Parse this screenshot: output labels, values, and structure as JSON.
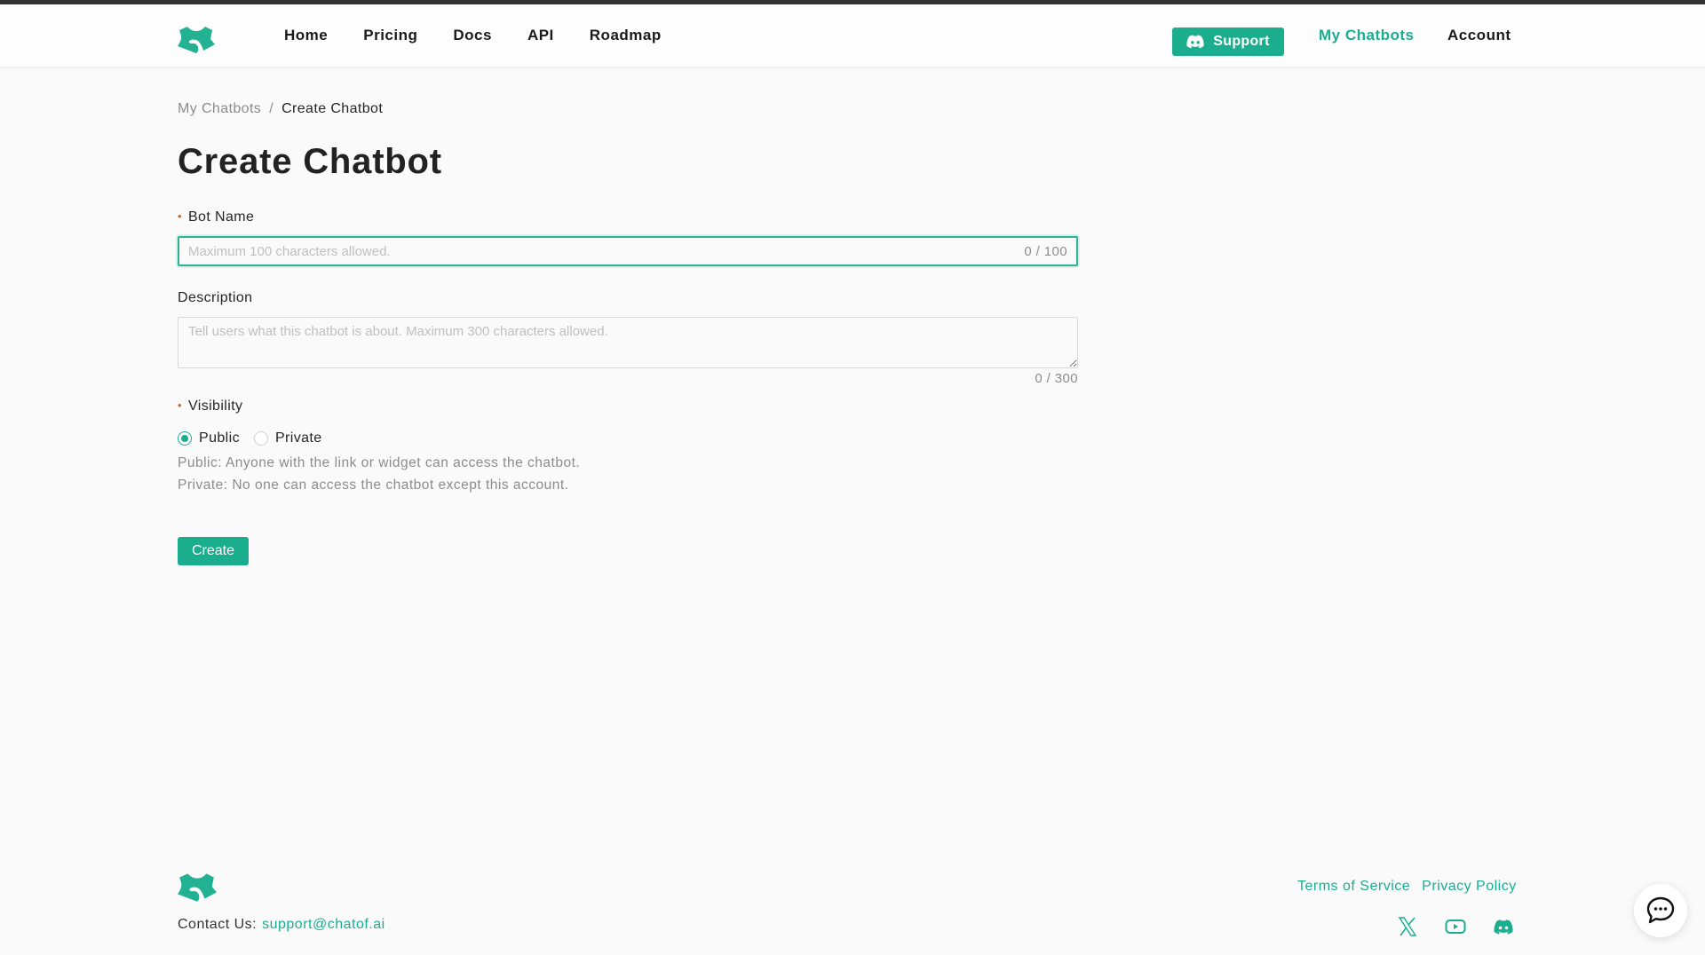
{
  "brand": {
    "accent": "#1aae8f",
    "required_marker": "#c0692a"
  },
  "nav": {
    "items": [
      {
        "label": "Home"
      },
      {
        "label": "Pricing"
      },
      {
        "label": "Docs"
      },
      {
        "label": "API"
      },
      {
        "label": "Roadmap"
      }
    ],
    "support_label": "Support",
    "support_icon": "discord-icon",
    "my_chatbots": "My Chatbots",
    "account": "Account"
  },
  "breadcrumb": {
    "parent": "My Chatbots",
    "separator": "/",
    "current": "Create Chatbot"
  },
  "page_title": "Create Chatbot",
  "form": {
    "bot_name": {
      "required_mark": "•",
      "label": "Bot Name",
      "value": "",
      "placeholder": "Maximum 100 characters allowed.",
      "counter": "0 / 100"
    },
    "description": {
      "label": "Description",
      "value": "",
      "placeholder": "Tell users what this chatbot is about. Maximum 300 characters allowed.",
      "counter": "0 / 300"
    },
    "visibility": {
      "required_mark": "•",
      "label": "Visibility",
      "options": [
        {
          "label": "Public",
          "checked": true
        },
        {
          "label": "Private",
          "checked": false
        }
      ],
      "help_public": "Public: Anyone with the link or widget can access the chatbot.",
      "help_private": "Private: No one can access the chatbot except this account."
    },
    "create_label": "Create"
  },
  "footer": {
    "contact_label": "Contact Us:",
    "contact_email": "support@chatof.ai",
    "links": [
      {
        "label": "Terms of Service"
      },
      {
        "label": "Privacy Policy"
      }
    ],
    "social": [
      "x-icon",
      "youtube-icon",
      "discord-icon"
    ]
  },
  "chat_widget_icon": "chat-bubble-icon"
}
